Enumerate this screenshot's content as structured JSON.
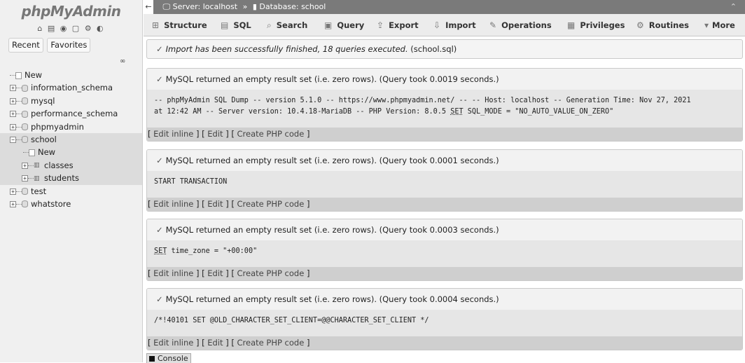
{
  "nav": {
    "logo": "phpMyAdmin",
    "quick_icons": "⌂ ▤ ◉ ▢ ⚙ ◐",
    "tabs": [
      "Recent",
      "Favorites"
    ],
    "tree": [
      {
        "label": "New",
        "kind": "new",
        "indent": 0
      },
      {
        "label": "information_schema",
        "kind": "db",
        "indent": 0
      },
      {
        "label": "mysql",
        "kind": "db",
        "indent": 0
      },
      {
        "label": "performance_schema",
        "kind": "db",
        "indent": 0
      },
      {
        "label": "phpmyadmin",
        "kind": "db",
        "indent": 0
      },
      {
        "label": "school",
        "kind": "db-open",
        "indent": 0
      },
      {
        "label": "New",
        "kind": "new",
        "indent": 1
      },
      {
        "label": "classes",
        "kind": "table",
        "indent": 1
      },
      {
        "label": "students",
        "kind": "table",
        "indent": 1
      },
      {
        "label": "test",
        "kind": "db",
        "indent": 0
      },
      {
        "label": "whatstore",
        "kind": "db",
        "indent": 0
      }
    ]
  },
  "breadcrumb": {
    "server": "Server: localhost",
    "separator": "»",
    "database": "Database: school"
  },
  "tabs": [
    {
      "label": "Structure",
      "icon": "structure-icon"
    },
    {
      "label": "SQL",
      "icon": "sql-icon"
    },
    {
      "label": "Search",
      "icon": "search-icon"
    },
    {
      "label": "Query",
      "icon": "query-icon"
    },
    {
      "label": "Export",
      "icon": "export-icon"
    },
    {
      "label": "Import",
      "icon": "import-icon"
    },
    {
      "label": "Operations",
      "icon": "wrench-icon"
    },
    {
      "label": "Privileges",
      "icon": "privileges-icon"
    },
    {
      "label": "Routines",
      "icon": "routines-icon"
    },
    {
      "label": "More",
      "icon": "chevron-down-icon"
    }
  ],
  "success": {
    "message": "Import has been successfully finished, 18 queries executed.",
    "file": "(school.sql)"
  },
  "results": [
    {
      "message": "MySQL returned an empty result set (i.e. zero rows). (Query took 0.0019 seconds.)",
      "sql_line1": "-- phpMyAdmin SQL Dump -- version 5.1.0 -- https://www.phpmyadmin.net/ -- -- Host: localhost -- Generation Time: Nov 27, 2021",
      "sql_line2_pre": "at 12:42 AM -- Server version: 10.4.18-MariaDB -- PHP Version: 8.0.5 ",
      "sql_line2_kw": "SET",
      "sql_line2_post": " SQL_MODE = \"NO_AUTO_VALUE_ON_ZERO\""
    },
    {
      "message": "MySQL returned an empty result set (i.e. zero rows). (Query took 0.0001 seconds.)",
      "sql_line1": "START TRANSACTION"
    },
    {
      "message": "MySQL returned an empty result set (i.e. zero rows). (Query took 0.0003 seconds.)",
      "sql_kw": "SET",
      "sql_rest": " time_zone = \"+00:00\""
    },
    {
      "message": "MySQL returned an empty result set (i.e. zero rows). (Query took 0.0004 seconds.)",
      "sql_line1": "/*!40101 SET @OLD_CHARACTER_SET_CLIENT=@@CHARACTER_SET_CLIENT */"
    }
  ],
  "result_links": {
    "edit_inline": "Edit inline",
    "edit": "Edit",
    "create_php": "Create PHP code"
  },
  "console": "Console"
}
